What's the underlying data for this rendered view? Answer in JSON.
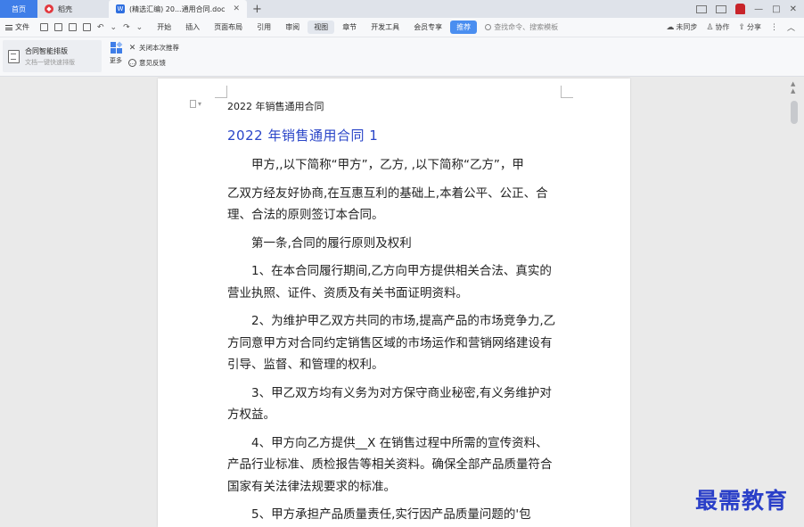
{
  "tabs": {
    "home": "首页",
    "daoke": "稻壳",
    "document": "(精选汇编) 20...通用合同.doc",
    "add": "+"
  },
  "window": {
    "minimize": "—",
    "restore": "□",
    "close": "✕"
  },
  "menubar": {
    "file": "文件",
    "items": [
      "开始",
      "插入",
      "页面布局",
      "引用",
      "审阅",
      "视图",
      "章节",
      "开发工具",
      "会员专享",
      "推荐"
    ],
    "active": "视图",
    "search_placeholder": "查找命令、搜索模板",
    "sync": "未同步",
    "collab": "协作",
    "share": "分享"
  },
  "ribbon": {
    "smart_title": "合同智能排版",
    "smart_subtitle": "文档一键快速排版",
    "more": "更多",
    "close_recommend": "关闭本次推荐",
    "feedback": "意见反馈"
  },
  "document": {
    "header": "2022 年销售通用合同",
    "title": "2022 年销售通用合同 1",
    "paragraphs": [
      "甲方,,以下简称“甲方”，乙方, ,以下简称“乙方”，甲",
      "乙双方经友好协商,在互惠互利的基础上,本着公平、公正、合理、合法的原则签订本合同。",
      "第一条,合同的履行原则及权利",
      "1、在本合同履行期间,乙方向甲方提供相关合法、真实的营业执照、证件、资质及有关书面证明资料。",
      "2、为维护甲乙双方共同的市场,提高产品的市场竞争力,乙方同意甲方对合同约定销售区域的市场运作和营销网络建设有引导、监督、和管理的权利。",
      "3、甲乙双方均有义务为对方保守商业秘密,有义务维护对方权益。",
      "4、甲方向乙方提供__X 在销售过程中所需的宣传资料、产品行业标准、质检报告等相关资料。确保全部产品质量符合国家有关法律法规要求的标准。",
      "5、甲方承担产品质量责任,实行因产品质量问题的'包"
    ]
  },
  "watermark": "最需教育",
  "colors": {
    "accent": "#3f7ee8",
    "title": "#2a45c8",
    "watermark": "#2a3fc8"
  }
}
